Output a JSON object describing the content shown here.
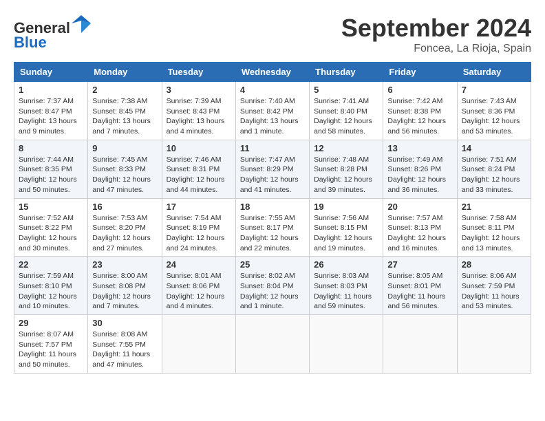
{
  "header": {
    "logo_line1": "General",
    "logo_line2": "Blue",
    "month": "September 2024",
    "location": "Foncea, La Rioja, Spain"
  },
  "weekdays": [
    "Sunday",
    "Monday",
    "Tuesday",
    "Wednesday",
    "Thursday",
    "Friday",
    "Saturday"
  ],
  "weeks": [
    [
      {
        "day": "1",
        "sunrise": "7:37 AM",
        "sunset": "8:47 PM",
        "daylight": "13 hours and 9 minutes."
      },
      {
        "day": "2",
        "sunrise": "7:38 AM",
        "sunset": "8:45 PM",
        "daylight": "13 hours and 7 minutes."
      },
      {
        "day": "3",
        "sunrise": "7:39 AM",
        "sunset": "8:43 PM",
        "daylight": "13 hours and 4 minutes."
      },
      {
        "day": "4",
        "sunrise": "7:40 AM",
        "sunset": "8:42 PM",
        "daylight": "13 hours and 1 minute."
      },
      {
        "day": "5",
        "sunrise": "7:41 AM",
        "sunset": "8:40 PM",
        "daylight": "12 hours and 58 minutes."
      },
      {
        "day": "6",
        "sunrise": "7:42 AM",
        "sunset": "8:38 PM",
        "daylight": "12 hours and 56 minutes."
      },
      {
        "day": "7",
        "sunrise": "7:43 AM",
        "sunset": "8:36 PM",
        "daylight": "12 hours and 53 minutes."
      }
    ],
    [
      {
        "day": "8",
        "sunrise": "7:44 AM",
        "sunset": "8:35 PM",
        "daylight": "12 hours and 50 minutes."
      },
      {
        "day": "9",
        "sunrise": "7:45 AM",
        "sunset": "8:33 PM",
        "daylight": "12 hours and 47 minutes."
      },
      {
        "day": "10",
        "sunrise": "7:46 AM",
        "sunset": "8:31 PM",
        "daylight": "12 hours and 44 minutes."
      },
      {
        "day": "11",
        "sunrise": "7:47 AM",
        "sunset": "8:29 PM",
        "daylight": "12 hours and 41 minutes."
      },
      {
        "day": "12",
        "sunrise": "7:48 AM",
        "sunset": "8:28 PM",
        "daylight": "12 hours and 39 minutes."
      },
      {
        "day": "13",
        "sunrise": "7:49 AM",
        "sunset": "8:26 PM",
        "daylight": "12 hours and 36 minutes."
      },
      {
        "day": "14",
        "sunrise": "7:51 AM",
        "sunset": "8:24 PM",
        "daylight": "12 hours and 33 minutes."
      }
    ],
    [
      {
        "day": "15",
        "sunrise": "7:52 AM",
        "sunset": "8:22 PM",
        "daylight": "12 hours and 30 minutes."
      },
      {
        "day": "16",
        "sunrise": "7:53 AM",
        "sunset": "8:20 PM",
        "daylight": "12 hours and 27 minutes."
      },
      {
        "day": "17",
        "sunrise": "7:54 AM",
        "sunset": "8:19 PM",
        "daylight": "12 hours and 24 minutes."
      },
      {
        "day": "18",
        "sunrise": "7:55 AM",
        "sunset": "8:17 PM",
        "daylight": "12 hours and 22 minutes."
      },
      {
        "day": "19",
        "sunrise": "7:56 AM",
        "sunset": "8:15 PM",
        "daylight": "12 hours and 19 minutes."
      },
      {
        "day": "20",
        "sunrise": "7:57 AM",
        "sunset": "8:13 PM",
        "daylight": "12 hours and 16 minutes."
      },
      {
        "day": "21",
        "sunrise": "7:58 AM",
        "sunset": "8:11 PM",
        "daylight": "12 hours and 13 minutes."
      }
    ],
    [
      {
        "day": "22",
        "sunrise": "7:59 AM",
        "sunset": "8:10 PM",
        "daylight": "12 hours and 10 minutes."
      },
      {
        "day": "23",
        "sunrise": "8:00 AM",
        "sunset": "8:08 PM",
        "daylight": "12 hours and 7 minutes."
      },
      {
        "day": "24",
        "sunrise": "8:01 AM",
        "sunset": "8:06 PM",
        "daylight": "12 hours and 4 minutes."
      },
      {
        "day": "25",
        "sunrise": "8:02 AM",
        "sunset": "8:04 PM",
        "daylight": "12 hours and 1 minute."
      },
      {
        "day": "26",
        "sunrise": "8:03 AM",
        "sunset": "8:03 PM",
        "daylight": "11 hours and 59 minutes."
      },
      {
        "day": "27",
        "sunrise": "8:05 AM",
        "sunset": "8:01 PM",
        "daylight": "11 hours and 56 minutes."
      },
      {
        "day": "28",
        "sunrise": "8:06 AM",
        "sunset": "7:59 PM",
        "daylight": "11 hours and 53 minutes."
      }
    ],
    [
      {
        "day": "29",
        "sunrise": "8:07 AM",
        "sunset": "7:57 PM",
        "daylight": "11 hours and 50 minutes."
      },
      {
        "day": "30",
        "sunrise": "8:08 AM",
        "sunset": "7:55 PM",
        "daylight": "11 hours and 47 minutes."
      },
      null,
      null,
      null,
      null,
      null
    ]
  ]
}
